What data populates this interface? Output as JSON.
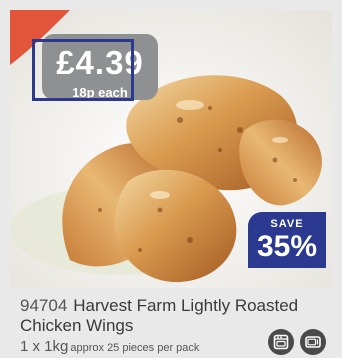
{
  "price": {
    "amount": "£4.39",
    "per_item": "18p each"
  },
  "save": {
    "label": "SAVE",
    "value": "35%"
  },
  "product": {
    "code": "94704",
    "name_line1": "Harvest Farm Lightly Roasted",
    "name_line2": "Chicken Wings",
    "pack": "1 x 1kg",
    "pack_detail": "approx 25 pieces per pack"
  },
  "icons": [
    "oven-icon",
    "microwave-icon"
  ],
  "colors": {
    "price_tag": "#8f9092",
    "accent_blue": "#2b3990",
    "text": "#555555"
  }
}
